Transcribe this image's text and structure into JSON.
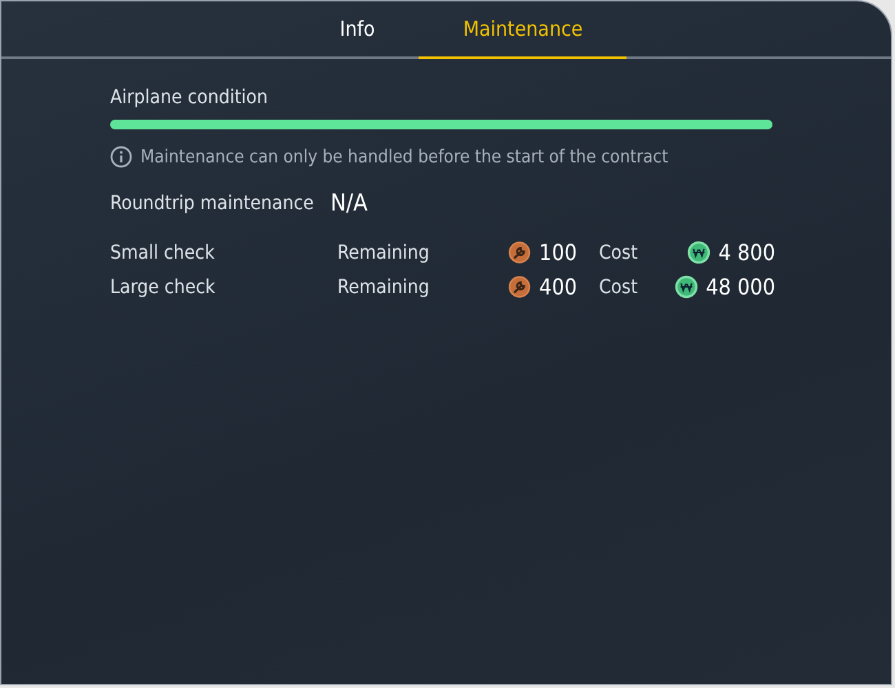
{
  "tabs": [
    {
      "label": "Info",
      "selected": false
    },
    {
      "label": "Maintenance",
      "selected": true
    }
  ],
  "condition": {
    "label": "Airplane condition",
    "level": 1.0
  },
  "notice": "Maintenance can only be handled before the start of the contract",
  "roundtrip": {
    "label": "Roundtrip maintenance",
    "value": "N/A"
  },
  "checks": [
    {
      "name": "Small check",
      "remaining_label": "Remaining",
      "remaining": "100",
      "cost_label": "Cost",
      "cost": "4 800"
    },
    {
      "name": "Large check",
      "remaining_label": "Remaining",
      "remaining": "400",
      "cost_label": "Cost",
      "cost": "48 000"
    }
  ]
}
